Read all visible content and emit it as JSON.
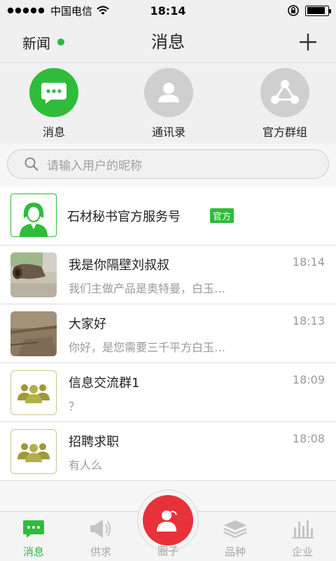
{
  "status_bar": {
    "carrier": "中国电信",
    "time": "18:14"
  },
  "header": {
    "left_label": "新闻",
    "title": "消息",
    "dot_color": "#1fbf3a"
  },
  "tiles": [
    {
      "label": "消息",
      "color": "#2ebc3a"
    },
    {
      "label": "通讯录",
      "color": "#cfcfcf"
    },
    {
      "label": "官方群组",
      "color": "#cfcfcf"
    }
  ],
  "search": {
    "placeholder": "请输入用户的昵称"
  },
  "official": {
    "name": "石材秘书官方服务号",
    "badge": "官方"
  },
  "conversations": [
    {
      "title": "我是你隔壁刘叔叔",
      "time": "18:14",
      "preview": "我们主做产品是奥特曼，白玉…"
    },
    {
      "title": "大家好",
      "time": "18:13",
      "preview": "你好，是您需要三千平方白玉…"
    },
    {
      "title": "信息交流群1",
      "time": "18:09",
      "preview": "？"
    },
    {
      "title": "招聘求职",
      "time": "18:08",
      "preview": "有人么"
    }
  ],
  "tabbar": {
    "messages": "消息",
    "supply": "供求",
    "circle": "圈子",
    "varieties": "品种",
    "enterprise": "企业",
    "active_color": "#2ebc3a",
    "center_color": "#e8323a"
  }
}
